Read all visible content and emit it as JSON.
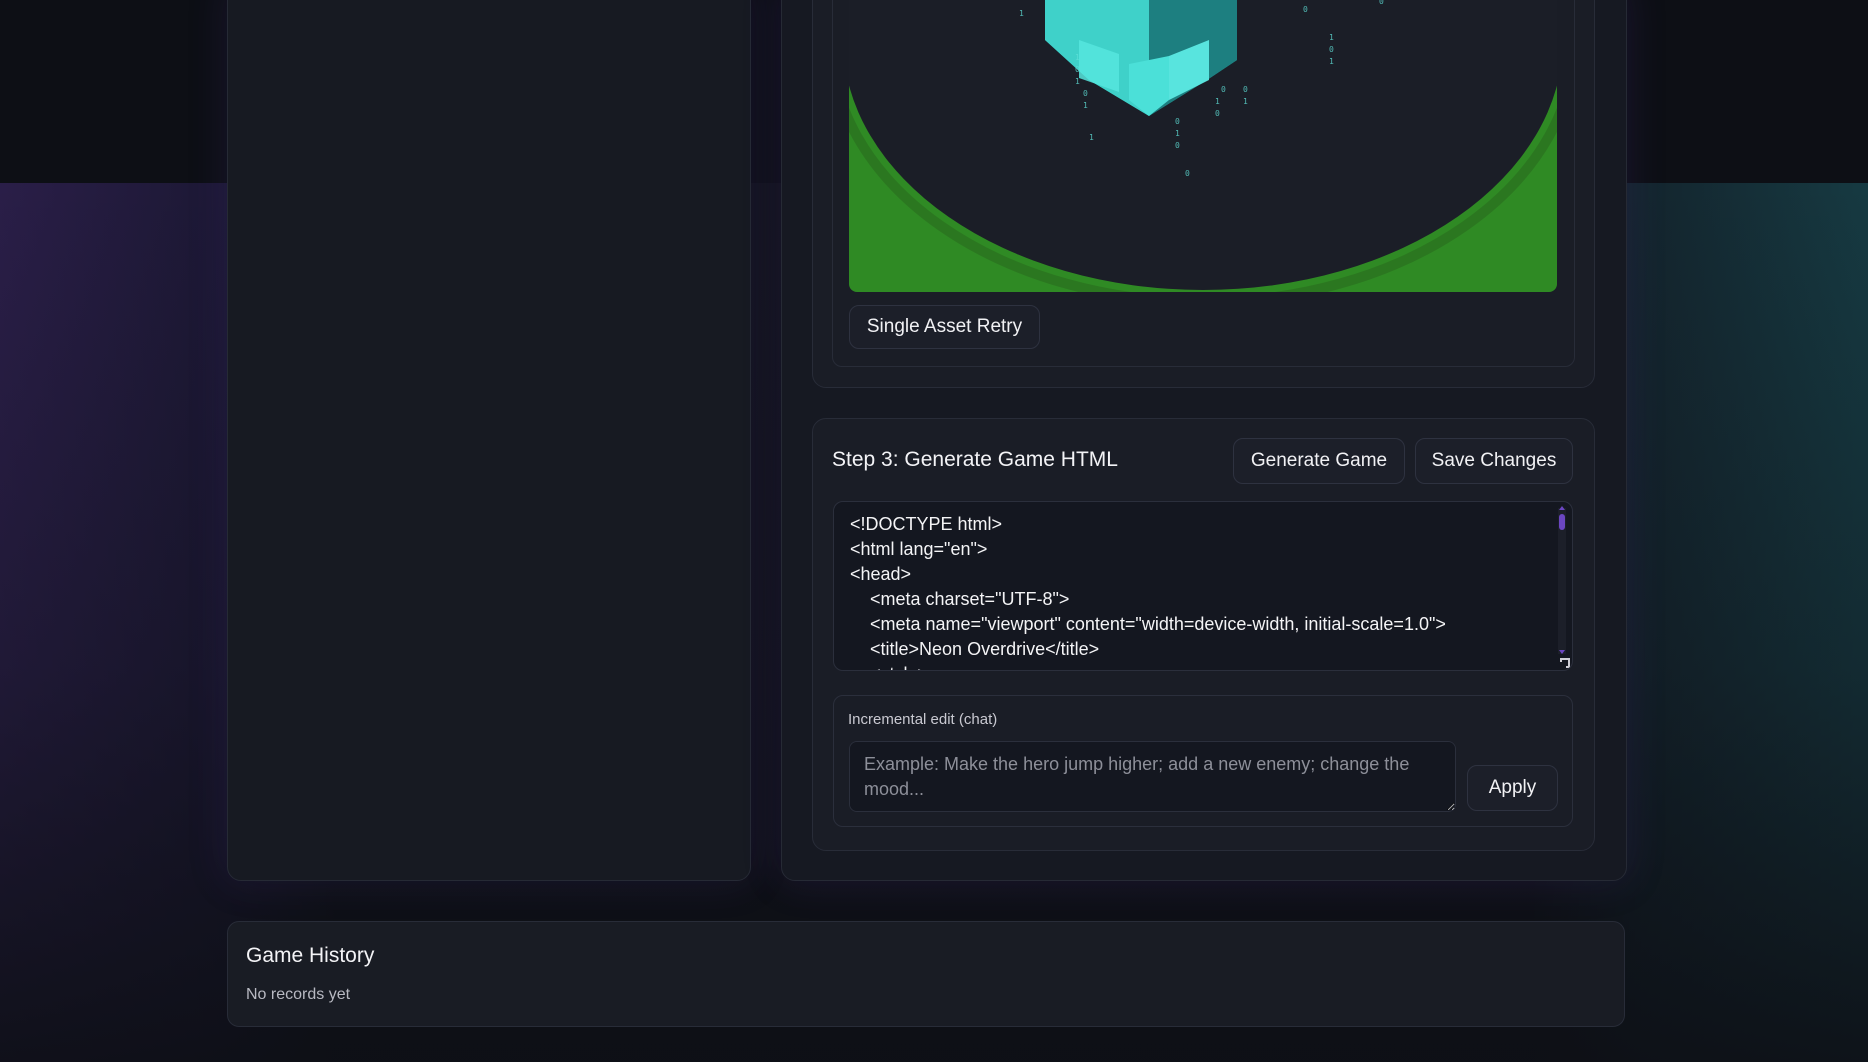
{
  "asset_preview": {
    "retry_button_label": "Single Asset Retry",
    "image_icon": "neon-cube-artwork"
  },
  "step3": {
    "title": "Step 3: Generate Game HTML",
    "generate_label": "Generate Game",
    "save_label": "Save Changes",
    "code": "<!DOCTYPE html>\n<html lang=\"en\">\n<head>\n    <meta charset=\"UTF-8\">\n    <meta name=\"viewport\" content=\"width=device-width, initial-scale=1.0\">\n    <title>Neon Overdrive</title>\n    <style>"
  },
  "incremental_edit": {
    "label": "Incremental edit (chat)",
    "placeholder": "Example: Make the hero jump higher; add a new enemy; change the mood...",
    "value": "",
    "apply_label": "Apply"
  },
  "history": {
    "title": "Game History",
    "empty_text": "No records yet"
  },
  "colors": {
    "accent_purple": "#6b46c1",
    "panel_bg": "#1a1d26",
    "green_ground": "#2f8a24",
    "cube_cyan": "#5ff0e8"
  }
}
